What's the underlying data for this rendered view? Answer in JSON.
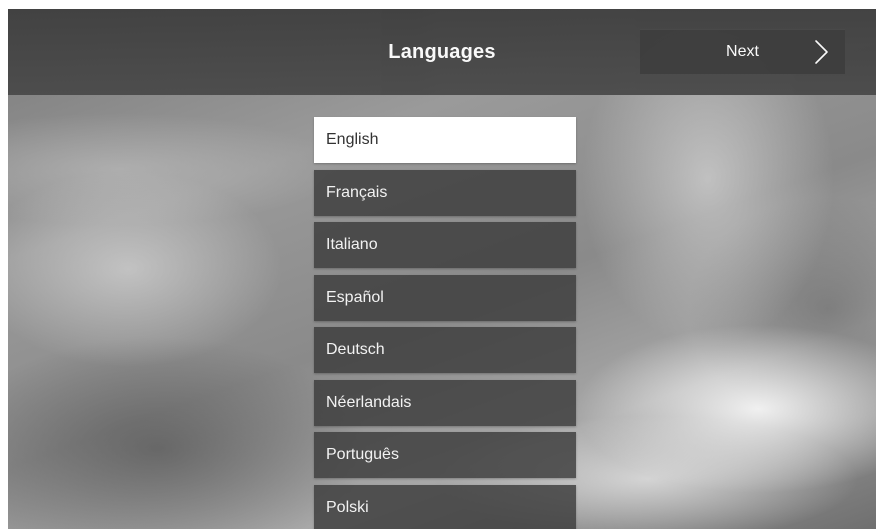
{
  "header": {
    "title": "Languages",
    "next_label": "Next",
    "next_icon": "chevron-right-icon"
  },
  "languages": {
    "selected": "English",
    "items": [
      {
        "label": "English"
      },
      {
        "label": "Français"
      },
      {
        "label": "Italiano"
      },
      {
        "label": "Español"
      },
      {
        "label": "Deutsch"
      },
      {
        "label": "Néerlandais"
      },
      {
        "label": "Português"
      },
      {
        "label": "Polski"
      }
    ]
  },
  "colors": {
    "header_bg": "#444444",
    "button_bg": "#3a3a3a",
    "item_bg": "#3c3c3c",
    "selected_bg": "#ffffff",
    "text_light": "#ffffff",
    "text_dark": "#333333"
  }
}
